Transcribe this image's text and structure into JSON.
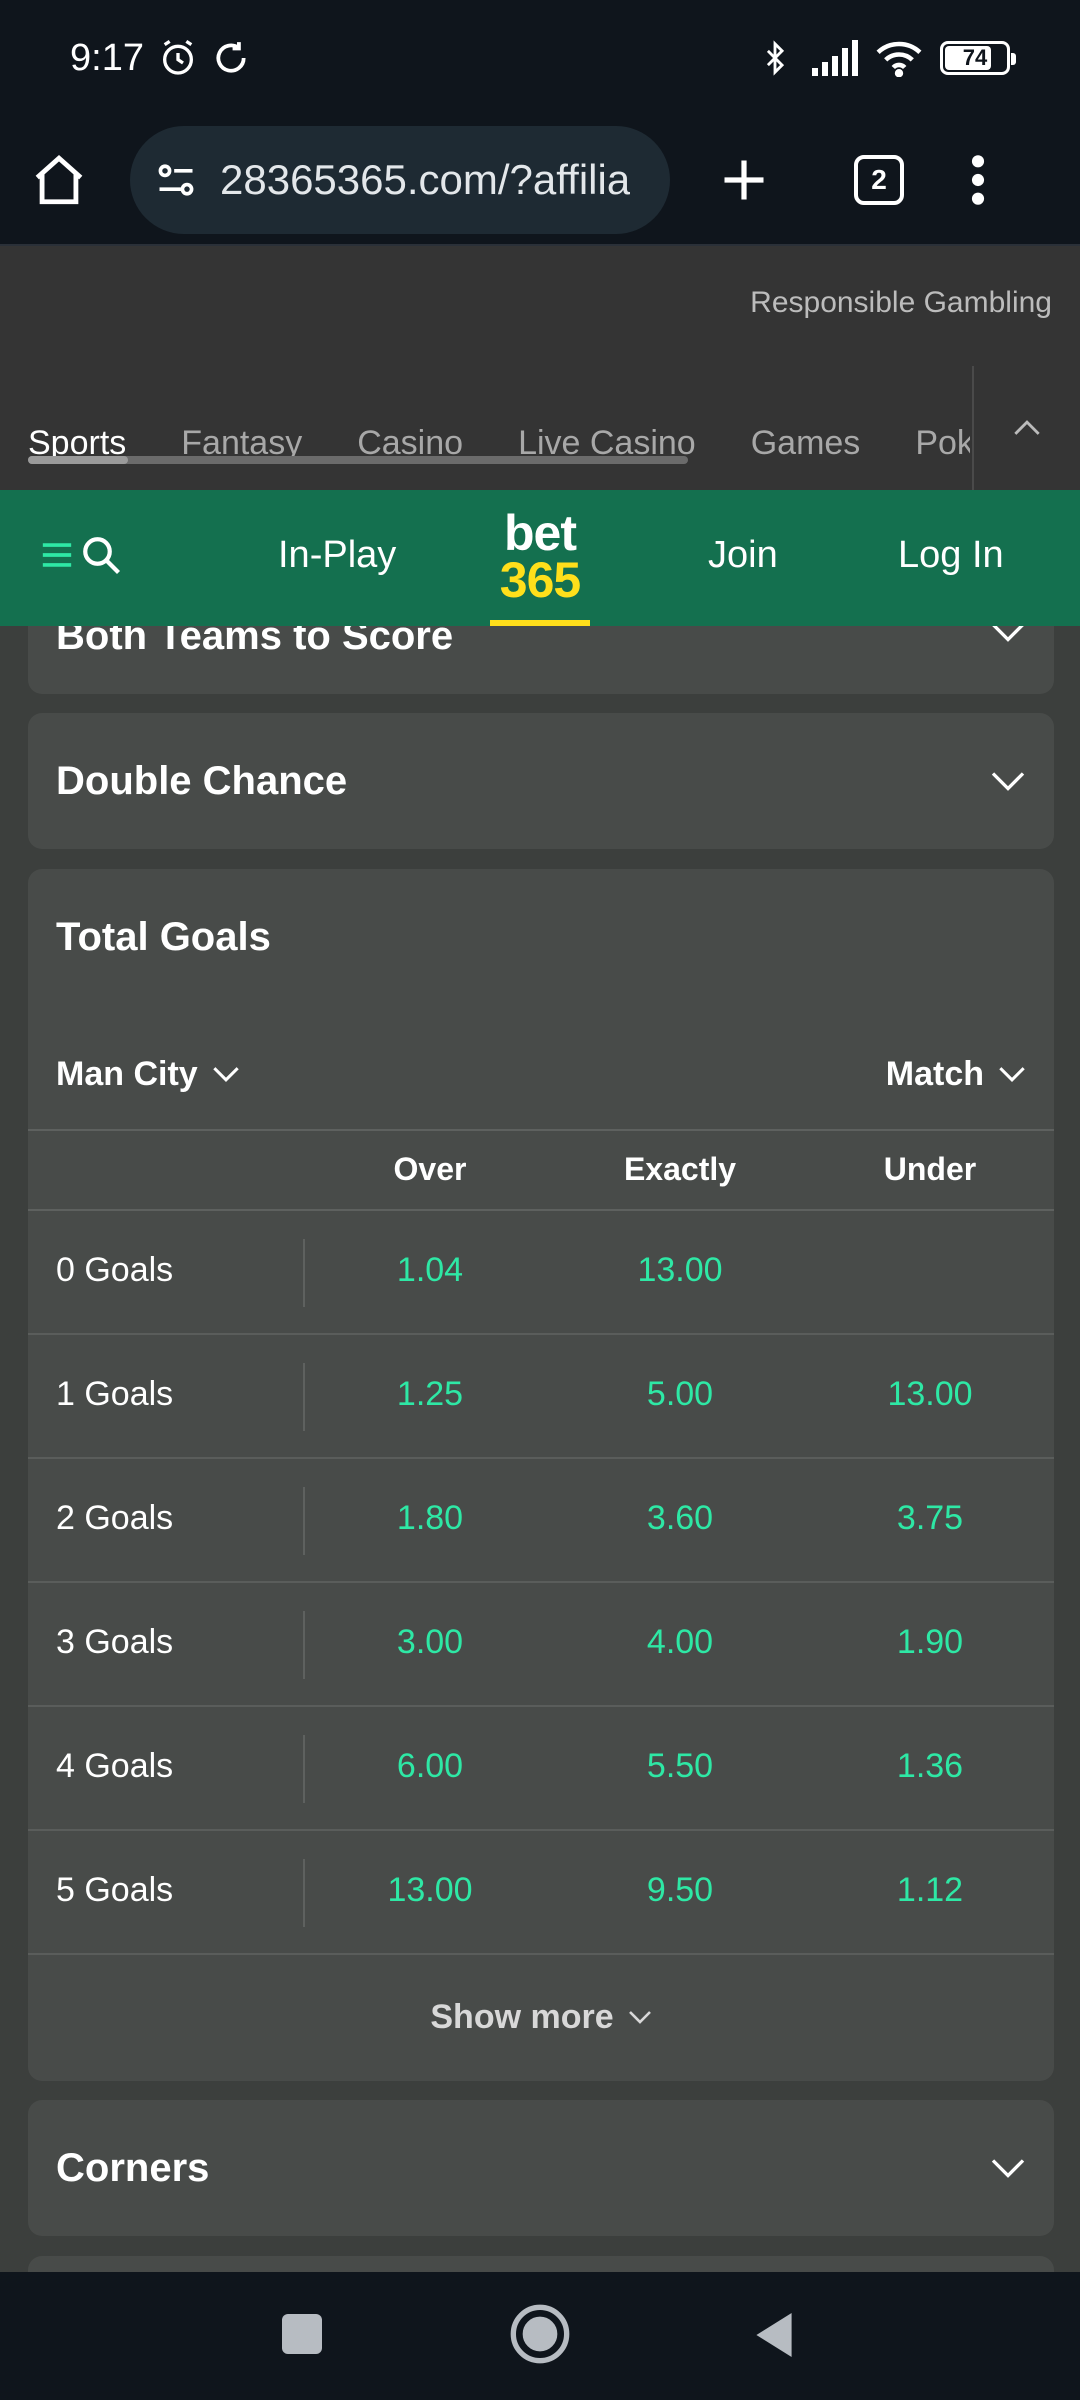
{
  "status_bar": {
    "time": "9:17",
    "battery": "74"
  },
  "browser": {
    "url": "28365365.com/?affilia",
    "tab_count": "2"
  },
  "site": {
    "responsible_gambling": "Responsible Gambling",
    "product_tabs": [
      "Sports",
      "Fantasy",
      "Casino",
      "Live Casino",
      "Games",
      "Pok"
    ],
    "nav": {
      "in_play": "In-Play",
      "logo_top": "bet",
      "logo_bottom": "365",
      "join": "Join",
      "log_in": "Log In"
    }
  },
  "markets": {
    "btts_title": "Both Teams to Score",
    "double_chance_title": "Double Chance",
    "total_goals": {
      "title": "Total Goals",
      "team_filter": "Man City",
      "period_filter": "Match",
      "columns": [
        "Over",
        "Exactly",
        "Under"
      ],
      "rows": [
        {
          "label": "0 Goals",
          "over": "1.04",
          "exactly": "13.00",
          "under": ""
        },
        {
          "label": "1 Goals",
          "over": "1.25",
          "exactly": "5.00",
          "under": "13.00"
        },
        {
          "label": "2 Goals",
          "over": "1.80",
          "exactly": "3.60",
          "under": "3.75"
        },
        {
          "label": "3 Goals",
          "over": "3.00",
          "exactly": "4.00",
          "under": "1.90"
        },
        {
          "label": "4 Goals",
          "over": "6.00",
          "exactly": "5.50",
          "under": "1.36"
        },
        {
          "label": "5 Goals",
          "over": "13.00",
          "exactly": "9.50",
          "under": "1.12"
        }
      ],
      "show_more": "Show more"
    },
    "corners_title": "Corners"
  },
  "colors": {
    "brand_green": "#14704f",
    "brand_yellow": "#ffdf1b",
    "odds_green": "#2ee8a5",
    "card_bg": "#484b49"
  }
}
